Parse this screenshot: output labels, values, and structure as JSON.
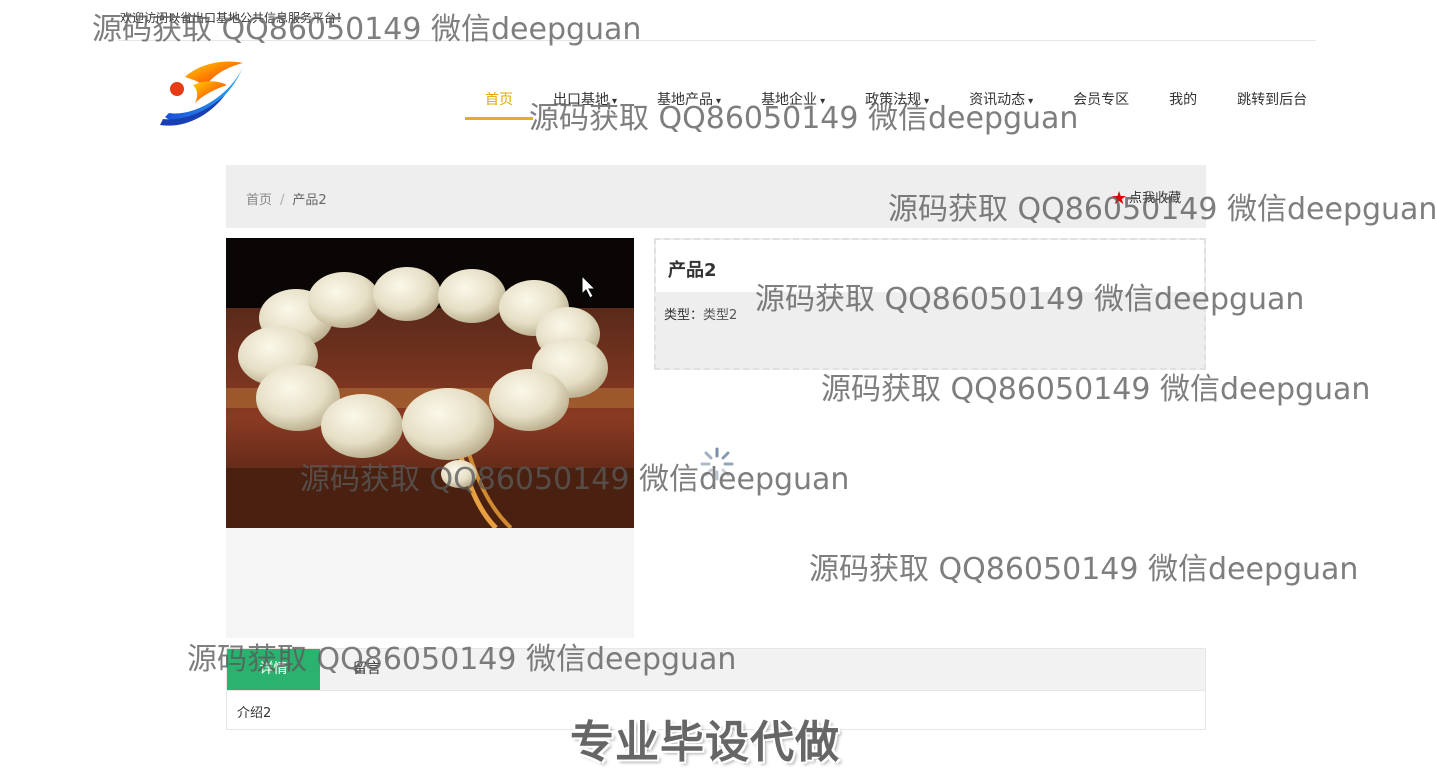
{
  "topbar": {
    "welcome": "欢迎访问以省出口基地公共信息服务平台！"
  },
  "nav": {
    "items": [
      {
        "label": "首页",
        "active": true
      },
      {
        "label": "出口基地",
        "caret": "▾"
      },
      {
        "label": "基地产品",
        "caret": "▾"
      },
      {
        "label": "基地企业",
        "caret": "▾"
      },
      {
        "label": "政策法规",
        "caret": "▾"
      },
      {
        "label": "资讯动态",
        "caret": "▾"
      },
      {
        "label": "会员专区"
      },
      {
        "label": "我的"
      },
      {
        "label": "跳转到后台"
      }
    ]
  },
  "breadcrumb": {
    "home": "首页",
    "separator": "/",
    "current": "产品2"
  },
  "favorite": {
    "label": "点我收藏",
    "icon": "star-icon",
    "color": "#e60000"
  },
  "product": {
    "title": "产品2",
    "type_label": "类型：",
    "type_value": "类型2"
  },
  "tabs": {
    "detail": "详情",
    "message": "留言",
    "content": "介绍2",
    "active_color": "#2ab26e"
  },
  "watermarks": [
    "源码获取 QQ86050149 微信deepguan",
    "源码获取 QQ86050149 微信deepguan",
    "源码获取 QQ86050149 微信deepguan",
    "源码获取 QQ86050149 微信deepguan",
    "源码获取 QQ86050149 微信deepguan",
    "源码获取 QQ86050149 微信deepguan",
    "源码获取 QQ86050149 微信deepguan",
    "源码获取 QQ86050149 微信deepguan"
  ],
  "promo": "专业毕设代做",
  "accent_color": "#e0a800"
}
